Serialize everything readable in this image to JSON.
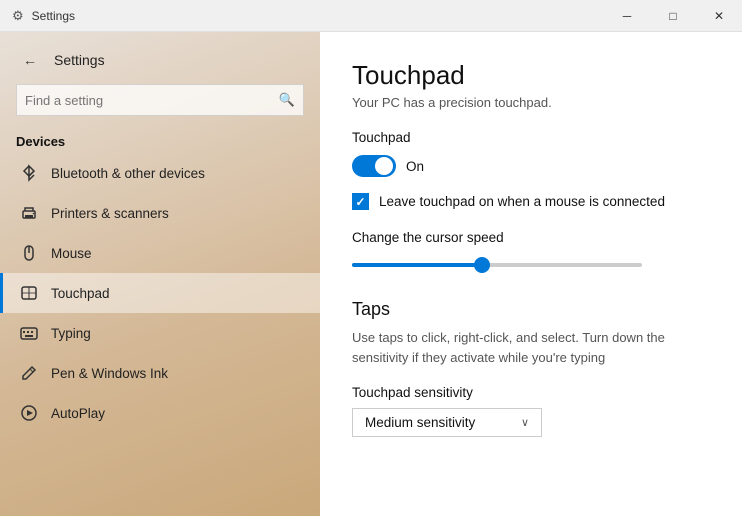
{
  "titlebar": {
    "title": "Settings",
    "minimize_label": "─",
    "maximize_label": "□",
    "close_label": "✕"
  },
  "sidebar": {
    "back_label": "←",
    "title": "Settings",
    "search_placeholder": "Find a setting",
    "section_label": "Devices",
    "nav_items": [
      {
        "id": "bluetooth",
        "label": "Bluetooth & other devices",
        "icon": "bluetooth"
      },
      {
        "id": "printers",
        "label": "Printers & scanners",
        "icon": "printer"
      },
      {
        "id": "mouse",
        "label": "Mouse",
        "icon": "mouse"
      },
      {
        "id": "touchpad",
        "label": "Touchpad",
        "icon": "touchpad",
        "active": true
      },
      {
        "id": "typing",
        "label": "Typing",
        "icon": "typing"
      },
      {
        "id": "pen",
        "label": "Pen & Windows Ink",
        "icon": "pen"
      },
      {
        "id": "autoplay",
        "label": "AutoPlay",
        "icon": "autoplay"
      }
    ]
  },
  "content": {
    "title": "Touchpad",
    "subtitle": "Your PC has a precision touchpad.",
    "touchpad_section_label": "Touchpad",
    "toggle_state": "On",
    "checkbox_label": "Leave touchpad on when a mouse is connected",
    "slider_label": "Change the cursor speed",
    "taps_title": "Taps",
    "taps_description": "Use taps to click, right-click, and select. Turn down the sensitivity if they activate while you're typing",
    "sensitivity_label": "Touchpad sensitivity",
    "sensitivity_value": "Medium sensitivity",
    "dropdown_arrow": "∨"
  }
}
